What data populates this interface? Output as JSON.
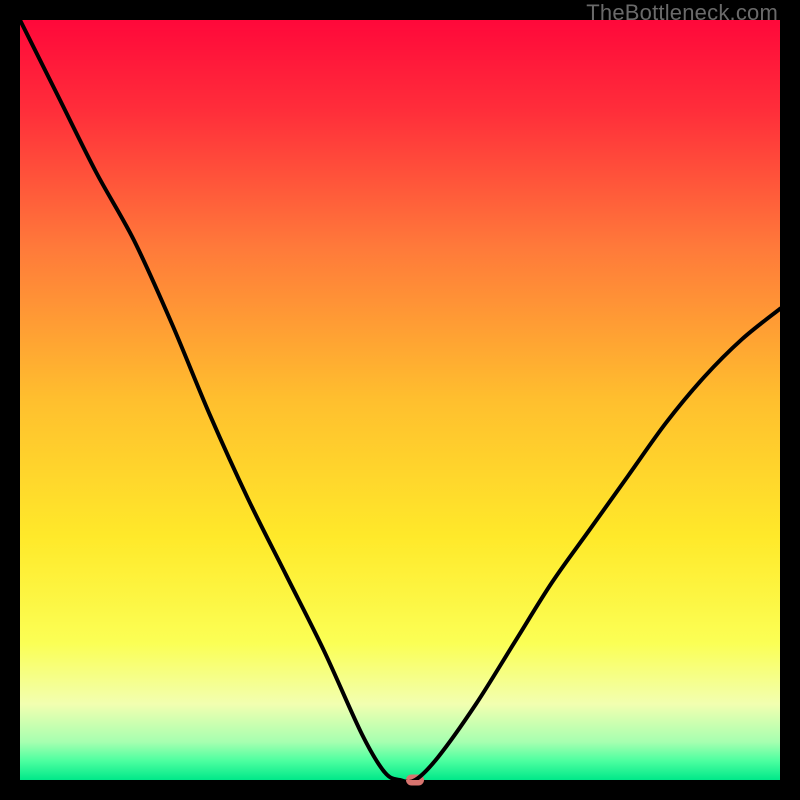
{
  "watermark": "TheBottleneck.com",
  "chart_data": {
    "type": "line",
    "title": "",
    "xlabel": "",
    "ylabel": "",
    "xlim": [
      0,
      100
    ],
    "ylim": [
      0,
      100
    ],
    "x": [
      0,
      5,
      10,
      15,
      20,
      25,
      30,
      35,
      40,
      45,
      48,
      50,
      52,
      55,
      60,
      65,
      70,
      75,
      80,
      85,
      90,
      95,
      100
    ],
    "values": [
      100,
      90,
      80,
      71,
      60,
      48,
      37,
      27,
      17,
      6,
      1,
      0,
      0,
      3,
      10,
      18,
      26,
      33,
      40,
      47,
      53,
      58,
      62
    ],
    "marker": {
      "x": 52,
      "y": 0
    },
    "gradient_stops": [
      {
        "pos": 0.0,
        "color": "#ff083a"
      },
      {
        "pos": 0.12,
        "color": "#ff2e3a"
      },
      {
        "pos": 0.3,
        "color": "#ff7a3a"
      },
      {
        "pos": 0.5,
        "color": "#ffbf2e"
      },
      {
        "pos": 0.68,
        "color": "#ffe92a"
      },
      {
        "pos": 0.82,
        "color": "#fbff55"
      },
      {
        "pos": 0.9,
        "color": "#f2ffb0"
      },
      {
        "pos": 0.95,
        "color": "#a6ffb0"
      },
      {
        "pos": 0.975,
        "color": "#4cffa0"
      },
      {
        "pos": 1.0,
        "color": "#00e889"
      }
    ]
  }
}
